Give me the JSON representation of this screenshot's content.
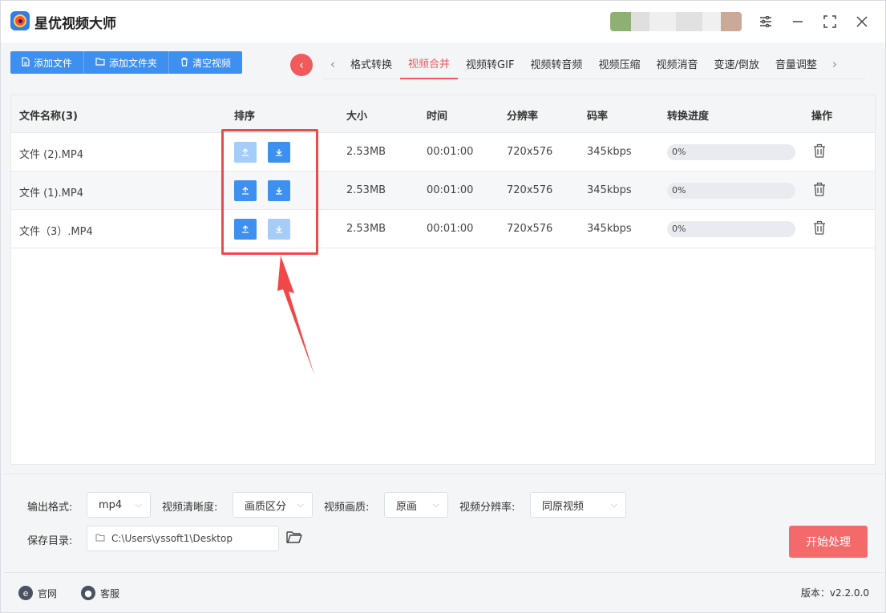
{
  "app": {
    "title": "星优视频大师"
  },
  "toolbar": {
    "add_file": "添加文件",
    "add_folder": "添加文件夹",
    "clear": "清空视频"
  },
  "tabs": [
    {
      "label": "格式转换"
    },
    {
      "label": "视频合并",
      "active": true
    },
    {
      "label": "视频转GIF"
    },
    {
      "label": "视频转音频"
    },
    {
      "label": "视频压缩"
    },
    {
      "label": "视频消音"
    },
    {
      "label": "变速/倒放"
    },
    {
      "label": "音量调整"
    }
  ],
  "table": {
    "headers": {
      "name": "文件名称(3)",
      "sort": "排序",
      "size": "大小",
      "time": "时间",
      "resolution": "分辨率",
      "bitrate": "码率",
      "progress": "转换进度",
      "action": "操作"
    },
    "rows": [
      {
        "name": "文件 (2).MP4",
        "size": "2.53MB",
        "time": "00:01:00",
        "resolution": "720x576",
        "bitrate": "345kbps",
        "progress": "0%",
        "up_enabled": false,
        "down_enabled": true
      },
      {
        "name": "文件 (1).MP4",
        "size": "2.53MB",
        "time": "00:01:00",
        "resolution": "720x576",
        "bitrate": "345kbps",
        "progress": "0%",
        "up_enabled": true,
        "down_enabled": true
      },
      {
        "name": "文件（3）.MP4",
        "size": "2.53MB",
        "time": "00:01:00",
        "resolution": "720x576",
        "bitrate": "345kbps",
        "progress": "0%",
        "up_enabled": true,
        "down_enabled": false
      }
    ]
  },
  "settings": {
    "output_format_label": "输出格式:",
    "output_format_value": "mp4",
    "clarity_label": "视频清晰度:",
    "clarity_value": "画质区分",
    "quality_label": "视频画质:",
    "quality_value": "原画",
    "resolution_label": "视频分辨率:",
    "resolution_value": "同原视频",
    "save_dir_label": "保存目录:",
    "save_dir_value": "C:\\Users\\yssoft1\\Desktop",
    "start_button": "开始处理"
  },
  "footer": {
    "website": "官网",
    "support": "客服",
    "version": "版本：v2.2.0.0"
  },
  "colors": {
    "accent": "#f15a5a",
    "primary": "#3d8ff0",
    "annotation": "#f04848"
  }
}
